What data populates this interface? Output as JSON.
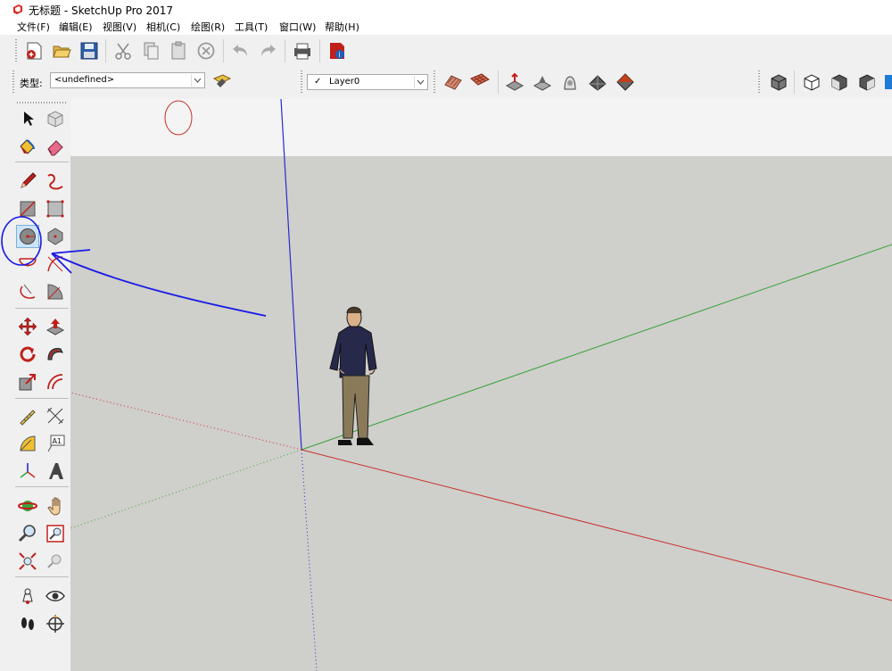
{
  "window": {
    "title": "无标题 - SketchUp Pro 2017"
  },
  "menu": [
    "文件(F)",
    "编辑(E)",
    "视图(V)",
    "相机(C)",
    "绘图(R)",
    "工具(T)",
    "窗口(W)",
    "帮助(H)"
  ],
  "components_bar": {
    "type_label": "类型:",
    "type_value": "<undefined>"
  },
  "layers_bar": {
    "current_layer": "Layer0",
    "check": "✓"
  },
  "tool_labels": {
    "text_tool": "A1"
  },
  "colors": {
    "sky": "#f3f4f3",
    "ground": "#cfcfcb",
    "axis_red": "#c9302c",
    "axis_green": "#3aa33a",
    "axis_blue": "#2a2ad0",
    "annotation_blue": "#1a1ae6",
    "selected_tool_bg": "#cce4f7"
  },
  "selected_tool": "circle-tool"
}
